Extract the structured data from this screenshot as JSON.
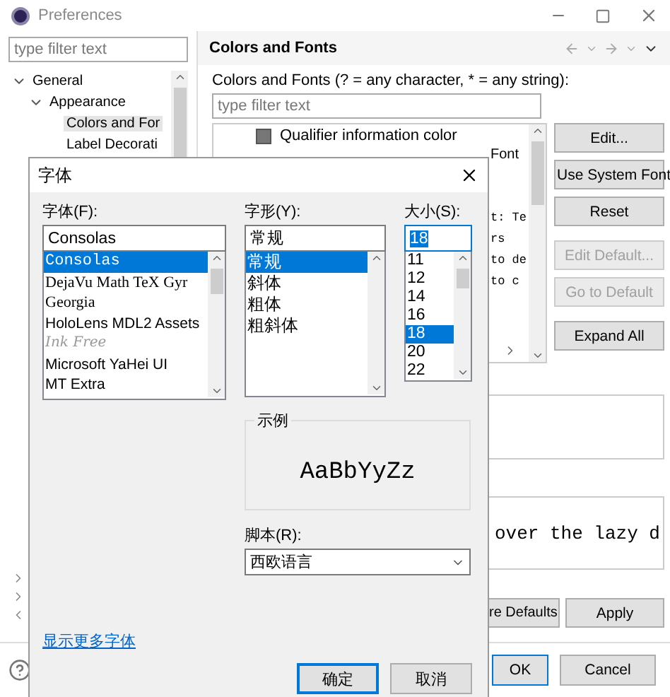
{
  "window": {
    "title": "Preferences"
  },
  "sidebar": {
    "filter_placeholder": "type filter text",
    "tree": [
      {
        "label": "General",
        "expanded": true,
        "children": [
          {
            "label": "Appearance",
            "expanded": true,
            "children": [
              {
                "label": "Colors and For",
                "selected": true
              },
              {
                "label": "Label Decorati",
                "selected": false
              }
            ]
          }
        ]
      }
    ]
  },
  "page": {
    "title": "Colors and Fonts",
    "filter_label": "Colors and Fonts (? = any character, * = any string):",
    "filter_placeholder": "type filter text",
    "tree_item": "Qualifier information color",
    "fragments": [
      {
        "text": "Font",
        "kind": "sans"
      },
      {
        "text": "t: Te",
        "kind": "mono"
      },
      {
        "text": "rs",
        "kind": "mono"
      },
      {
        "text": "to de",
        "kind": "mono"
      },
      {
        "text": "to c",
        "kind": "mono"
      }
    ],
    "buttons": [
      {
        "label": "Edit...",
        "disabled": false
      },
      {
        "label": "Use System Font",
        "disabled": false
      },
      {
        "label": "Reset",
        "disabled": false
      },
      {
        "label": "Edit Default...",
        "disabled": true
      },
      {
        "label": "Go to Default",
        "disabled": true
      },
      {
        "label": "Expand All",
        "disabled": false
      }
    ],
    "preview_text": "over the lazy d",
    "footer_buttons": [
      "re Defaults",
      "Apply"
    ],
    "dialog_buttons": [
      "OK",
      "Cancel"
    ]
  },
  "font_dialog": {
    "title": "字体",
    "font": {
      "label": "字体(F):",
      "value": "Consolas",
      "options": [
        {
          "label": "Consolas",
          "kind": "mono",
          "selected": true
        },
        {
          "label": "DejaVu Math TeX Gyr",
          "kind": "serif",
          "selected": false
        },
        {
          "label": "Georgia",
          "kind": "serif",
          "selected": false
        },
        {
          "label": "HoloLens MDL2 Assets",
          "kind": "sans",
          "selected": false
        },
        {
          "label": "Ink Free",
          "kind": "script",
          "selected": false
        },
        {
          "label": "Microsoft YaHei UI",
          "kind": "sans",
          "selected": false
        },
        {
          "label": "MT Extra",
          "kind": "sans",
          "selected": false
        }
      ]
    },
    "style": {
      "label": "字形(Y):",
      "value": "常规",
      "options": [
        {
          "label": "常规",
          "selected": true
        },
        {
          "label": "斜体",
          "selected": false
        },
        {
          "label": "粗体",
          "selected": false
        },
        {
          "label": "粗斜体",
          "selected": false
        }
      ]
    },
    "size": {
      "label": "大小(S):",
      "value": "18",
      "options": [
        {
          "label": "11",
          "selected": false
        },
        {
          "label": "12",
          "selected": false
        },
        {
          "label": "14",
          "selected": false
        },
        {
          "label": "16",
          "selected": false
        },
        {
          "label": "18",
          "selected": true
        },
        {
          "label": "20",
          "selected": false
        },
        {
          "label": "22",
          "selected": false
        }
      ]
    },
    "sample": {
      "label": "示例",
      "text": "AaBbYyZz"
    },
    "script": {
      "label": "脚本(R):",
      "value": "西欧语言"
    },
    "more_fonts_link": "显示更多字体",
    "buttons": [
      "确定",
      "取消"
    ]
  }
}
